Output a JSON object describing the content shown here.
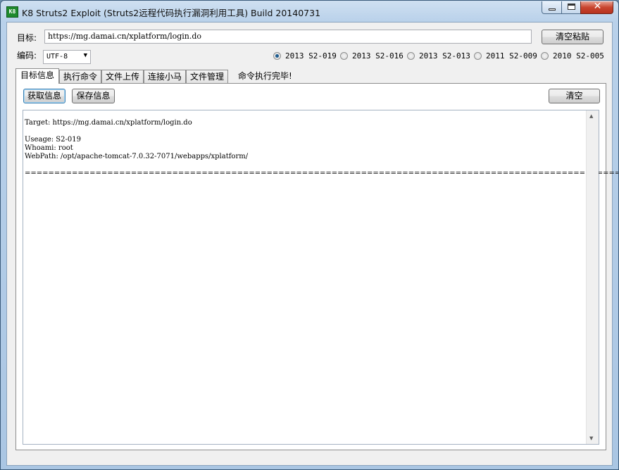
{
  "window": {
    "icon_text": "K8",
    "title": "K8 Struts2 Exploit (Struts2远程代码执行漏洞利用工具) Build 20140731"
  },
  "form": {
    "target_label": "目标:",
    "target_value": "https://mg.damai.cn/xplatform/login.do",
    "clear_paste_button": "清空粘贴",
    "encoding_label": "编码:",
    "encoding_value": "UTF-8"
  },
  "radios": [
    {
      "label": "2013 S2-019",
      "checked": true
    },
    {
      "label": "2013 S2-016",
      "checked": false
    },
    {
      "label": "2013 S2-013",
      "checked": false
    },
    {
      "label": "2011 S2-009",
      "checked": false
    },
    {
      "label": "2010 S2-005",
      "checked": false
    }
  ],
  "tabs": [
    {
      "label": "目标信息",
      "active": true
    },
    {
      "label": "执行命令",
      "active": false
    },
    {
      "label": "文件上传",
      "active": false
    },
    {
      "label": "连接小马",
      "active": false
    },
    {
      "label": "文件管理",
      "active": false
    }
  ],
  "status_text": "命令执行完毕!",
  "panel": {
    "get_info_button": "获取信息",
    "save_info_button": "保存信息",
    "clear_button": "清空"
  },
  "output": {
    "lines": [
      "Target: https://mg.damai.cn/xplatform/login.do",
      "",
      "Useage: S2-019",
      "Whoami: root",
      "WebPath: /opt/apache-tomcat-7.0.32-7071/webapps/xplatform/",
      "",
      "======================================================================================================================================"
    ]
  }
}
